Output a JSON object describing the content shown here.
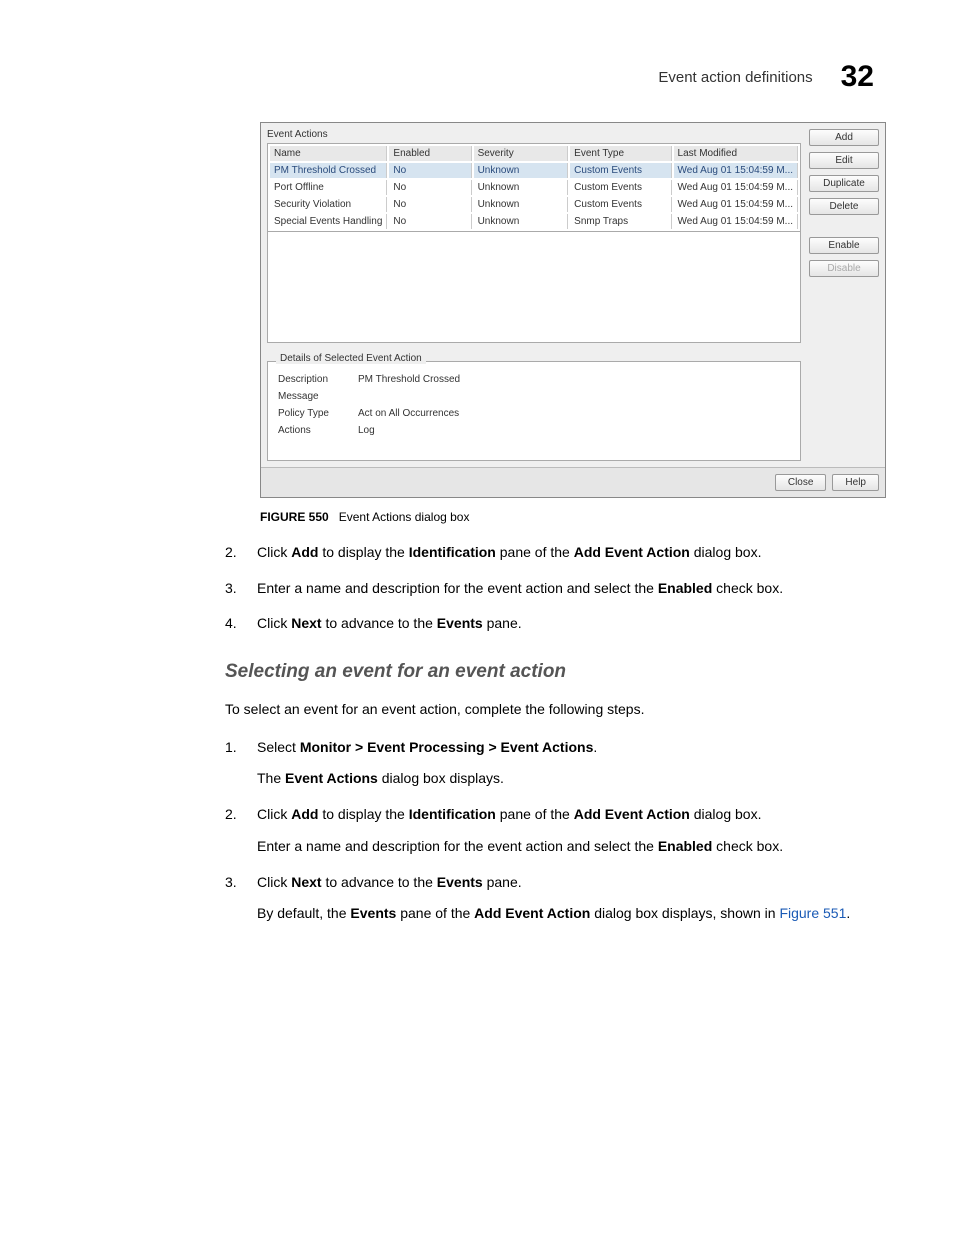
{
  "header": {
    "title": "Event action definitions",
    "page_number": "32"
  },
  "dialog": {
    "title": "Event Actions",
    "columns": [
      "Name",
      "Enabled",
      "Severity",
      "Event Type",
      "Last Modified"
    ],
    "rows": [
      {
        "name": "PM Threshold Crossed",
        "enabled": "No",
        "severity": "Unknown",
        "event_type": "Custom Events",
        "modified": "Wed Aug 01 15:04:59 M...",
        "selected": true
      },
      {
        "name": "Port Offline",
        "enabled": "No",
        "severity": "Unknown",
        "event_type": "Custom Events",
        "modified": "Wed Aug 01 15:04:59 M...",
        "selected": false
      },
      {
        "name": "Security Violation",
        "enabled": "No",
        "severity": "Unknown",
        "event_type": "Custom Events",
        "modified": "Wed Aug 01 15:04:59 M...",
        "selected": false
      },
      {
        "name": "Special Events Handling",
        "enabled": "No",
        "severity": "Unknown",
        "event_type": "Snmp Traps",
        "modified": "Wed Aug 01 15:04:59 M...",
        "selected": false
      }
    ],
    "buttons": {
      "add": "Add",
      "edit": "Edit",
      "duplicate": "Duplicate",
      "delete": "Delete",
      "enable": "Enable",
      "disable": "Disable"
    },
    "details_title": "Details of Selected Event Action",
    "details": {
      "description_label": "Description",
      "description_value": "PM Threshold Crossed",
      "message_label": "Message",
      "message_value": "",
      "policy_type_label": "Policy Type",
      "policy_type_value": "Act on All Occurrences",
      "actions_label": "Actions",
      "actions_value": "Log"
    },
    "footer": {
      "close": "Close",
      "help": "Help"
    }
  },
  "caption": {
    "label": "FIGURE 550",
    "text": "Event Actions dialog box"
  },
  "steps_a": {
    "s2_num": "2.",
    "s2_a": "Click ",
    "s2_b": "Add",
    "s2_c": " to display the ",
    "s2_d": "Identification",
    "s2_e": " pane of the ",
    "s2_f": "Add Event Action",
    "s2_g": " dialog box.",
    "s3_num": "3.",
    "s3_a": "Enter a name and description for the event action and select the ",
    "s3_b": "Enabled",
    "s3_c": " check box.",
    "s4_num": "4.",
    "s4_a": "Click ",
    "s4_b": "Next",
    "s4_c": " to advance to the ",
    "s4_d": "Events",
    "s4_e": " pane."
  },
  "subhead": "Selecting an event for an event action",
  "intro": "To select an event for an event action, complete the following steps.",
  "steps_b": {
    "s1_num": "1.",
    "s1_a": "Select ",
    "s1_b": "Monitor > Event Processing > Event Actions",
    "s1_c": ".",
    "s1_sub_a": "The ",
    "s1_sub_b": "Event Actions",
    "s1_sub_c": " dialog box displays.",
    "s2_num": "2.",
    "s2_a": "Click ",
    "s2_b": "Add",
    "s2_c": " to display the ",
    "s2_d": "Identification",
    "s2_e": " pane of the ",
    "s2_f": "Add Event Action",
    "s2_g": " dialog box.",
    "s2_sub_a": "Enter a name and description for the event action and select the ",
    "s2_sub_b": "Enabled",
    "s2_sub_c": " check box.",
    "s3_num": "3.",
    "s3_a": "Click ",
    "s3_b": "Next",
    "s3_c": " to advance to the ",
    "s3_d": "Events",
    "s3_e": " pane.",
    "s3_sub_a": "By default, the ",
    "s3_sub_b": "Events",
    "s3_sub_c": " pane of the ",
    "s3_sub_d": "Add Event Action",
    "s3_sub_e": " dialog box displays, shown in ",
    "s3_sub_link": "Figure 551",
    "s3_sub_f": "."
  }
}
